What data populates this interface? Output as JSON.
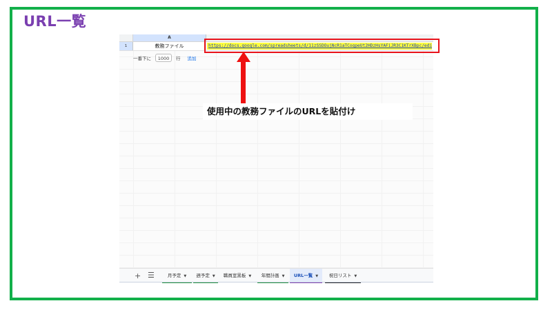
{
  "slide": {
    "title": "URL一覧"
  },
  "sheet": {
    "column_a_header": "A",
    "row1_number": "1",
    "cell_a1": "教務ファイル",
    "cell_b1_url": "https://docs.google.com/spreadsheets/d/11zSSDOujNcR1aTCogpeUt2HDzHsYAFiJR3C1KTrXBpc/edit#gid",
    "add_rows": {
      "label": "一番下に",
      "count": "1000",
      "unit": "行",
      "button": "追加"
    }
  },
  "callout": {
    "text": "使用中の教務ファイルのURLを貼付け"
  },
  "tabs": [
    {
      "label": "月予定",
      "color": "#1e8e3e"
    },
    {
      "label": "週予定",
      "color": "#1e8e3e"
    },
    {
      "label": "職員室黒板",
      "color": ""
    },
    {
      "label": "年間計画",
      "color": "#1e8e3e"
    },
    {
      "label": "URL一覧",
      "color": "#7a3fb0",
      "active": true
    },
    {
      "label": "祝日リスト",
      "color": "#202124"
    }
  ],
  "colors": {
    "frame": "#12b04a",
    "title": "#7a3fb0",
    "highlight": "#ffff3d",
    "annotation": "#e8121b"
  }
}
